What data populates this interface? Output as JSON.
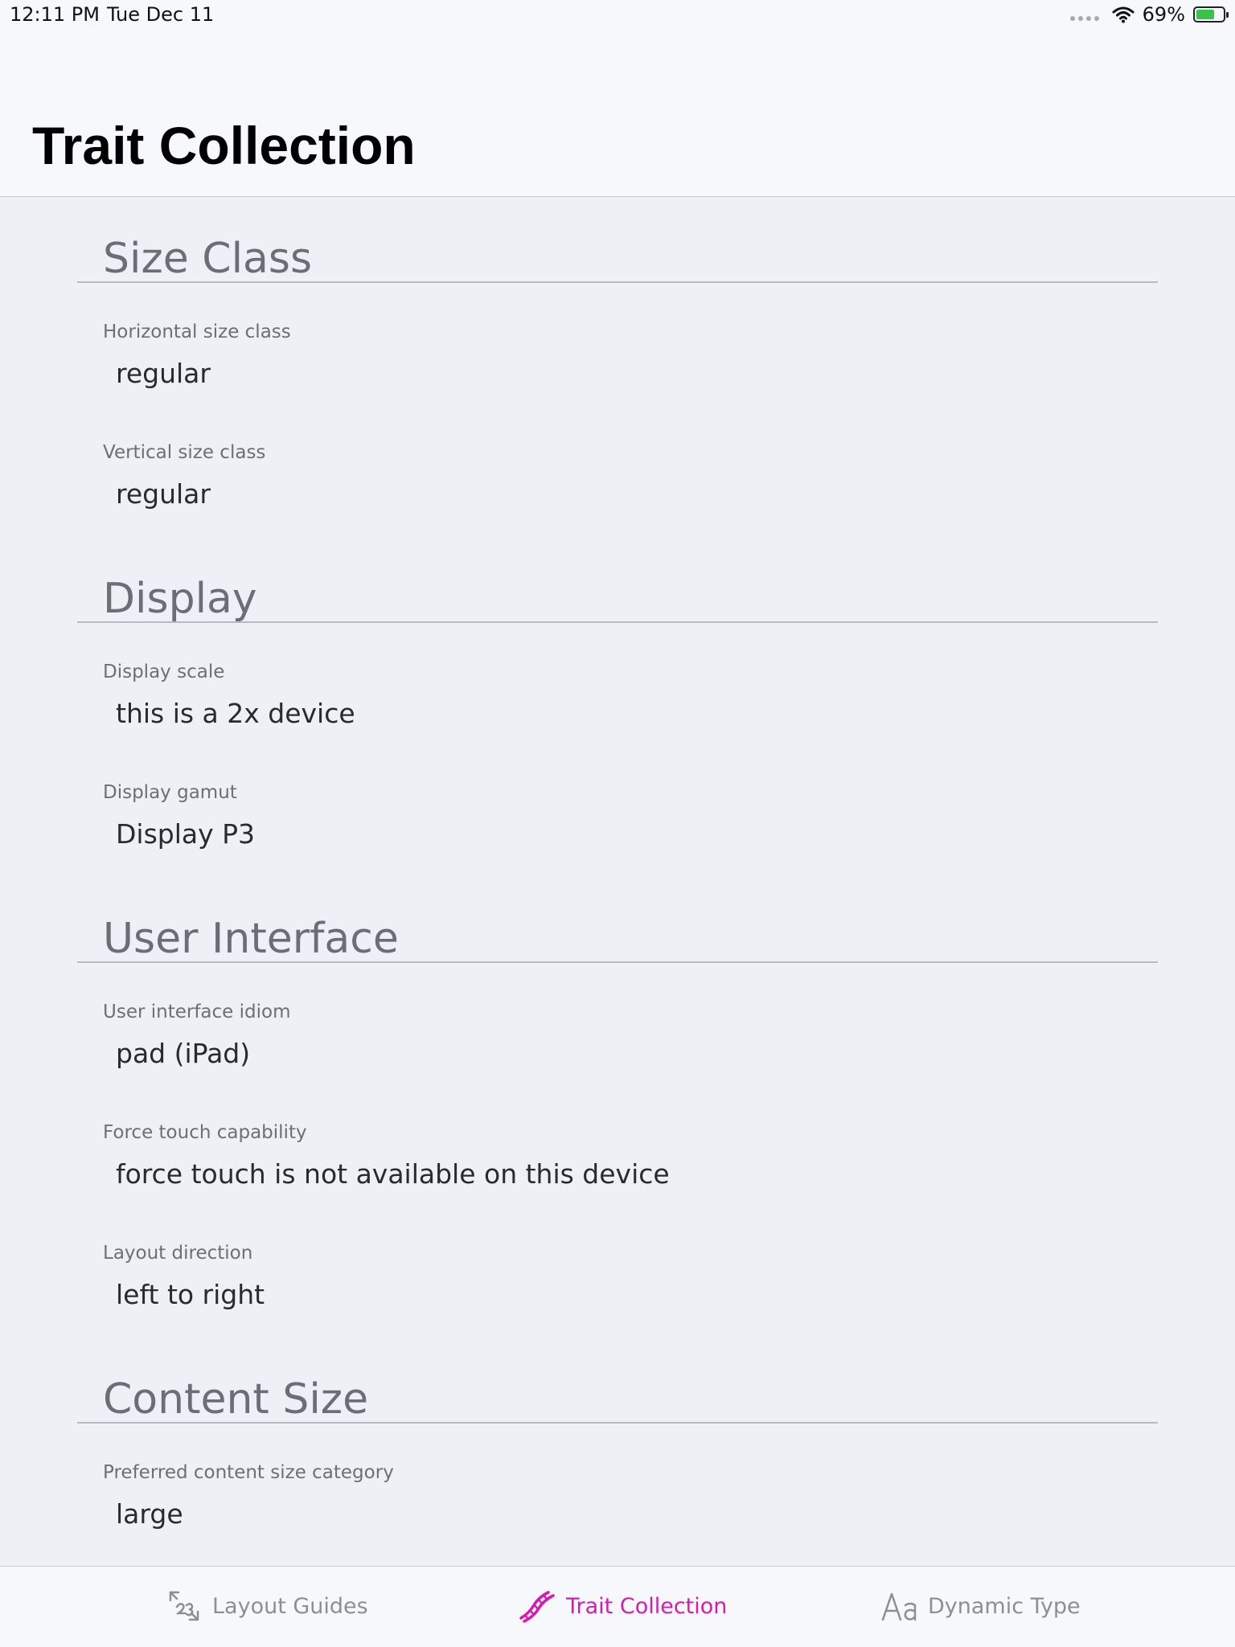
{
  "status_bar": {
    "time": "12:11 PM",
    "date": "Tue Dec 11",
    "battery": "69%",
    "battery_level": 0.69
  },
  "nav": {
    "title": "Trait Collection"
  },
  "sections": [
    {
      "title": "Size Class",
      "items": [
        {
          "label": "Horizontal size class",
          "value": "regular"
        },
        {
          "label": "Vertical size class",
          "value": "regular"
        }
      ]
    },
    {
      "title": "Display",
      "items": [
        {
          "label": "Display scale",
          "value": "this is a 2x device"
        },
        {
          "label": "Display gamut",
          "value": "Display P3"
        }
      ]
    },
    {
      "title": "User Interface",
      "items": [
        {
          "label": "User interface idiom",
          "value": "pad (iPad)"
        },
        {
          "label": "Force touch capability",
          "value": "force touch is not available on this device"
        },
        {
          "label": "Layout direction",
          "value": "left to right"
        }
      ]
    },
    {
      "title": "Content Size",
      "items": [
        {
          "label": "Preferred content size category",
          "value": "large"
        }
      ]
    }
  ],
  "tabs": [
    {
      "label": "Layout Guides",
      "icon": "layout-guides-icon",
      "active": false
    },
    {
      "label": "Trait Collection",
      "icon": "dna-icon",
      "active": true
    },
    {
      "label": "Dynamic Type",
      "icon": "text-size-icon",
      "active": false
    }
  ],
  "colors": {
    "accent": "#d61bb0",
    "background": "#eef0f6",
    "bar_background": "#f7f8fb"
  }
}
